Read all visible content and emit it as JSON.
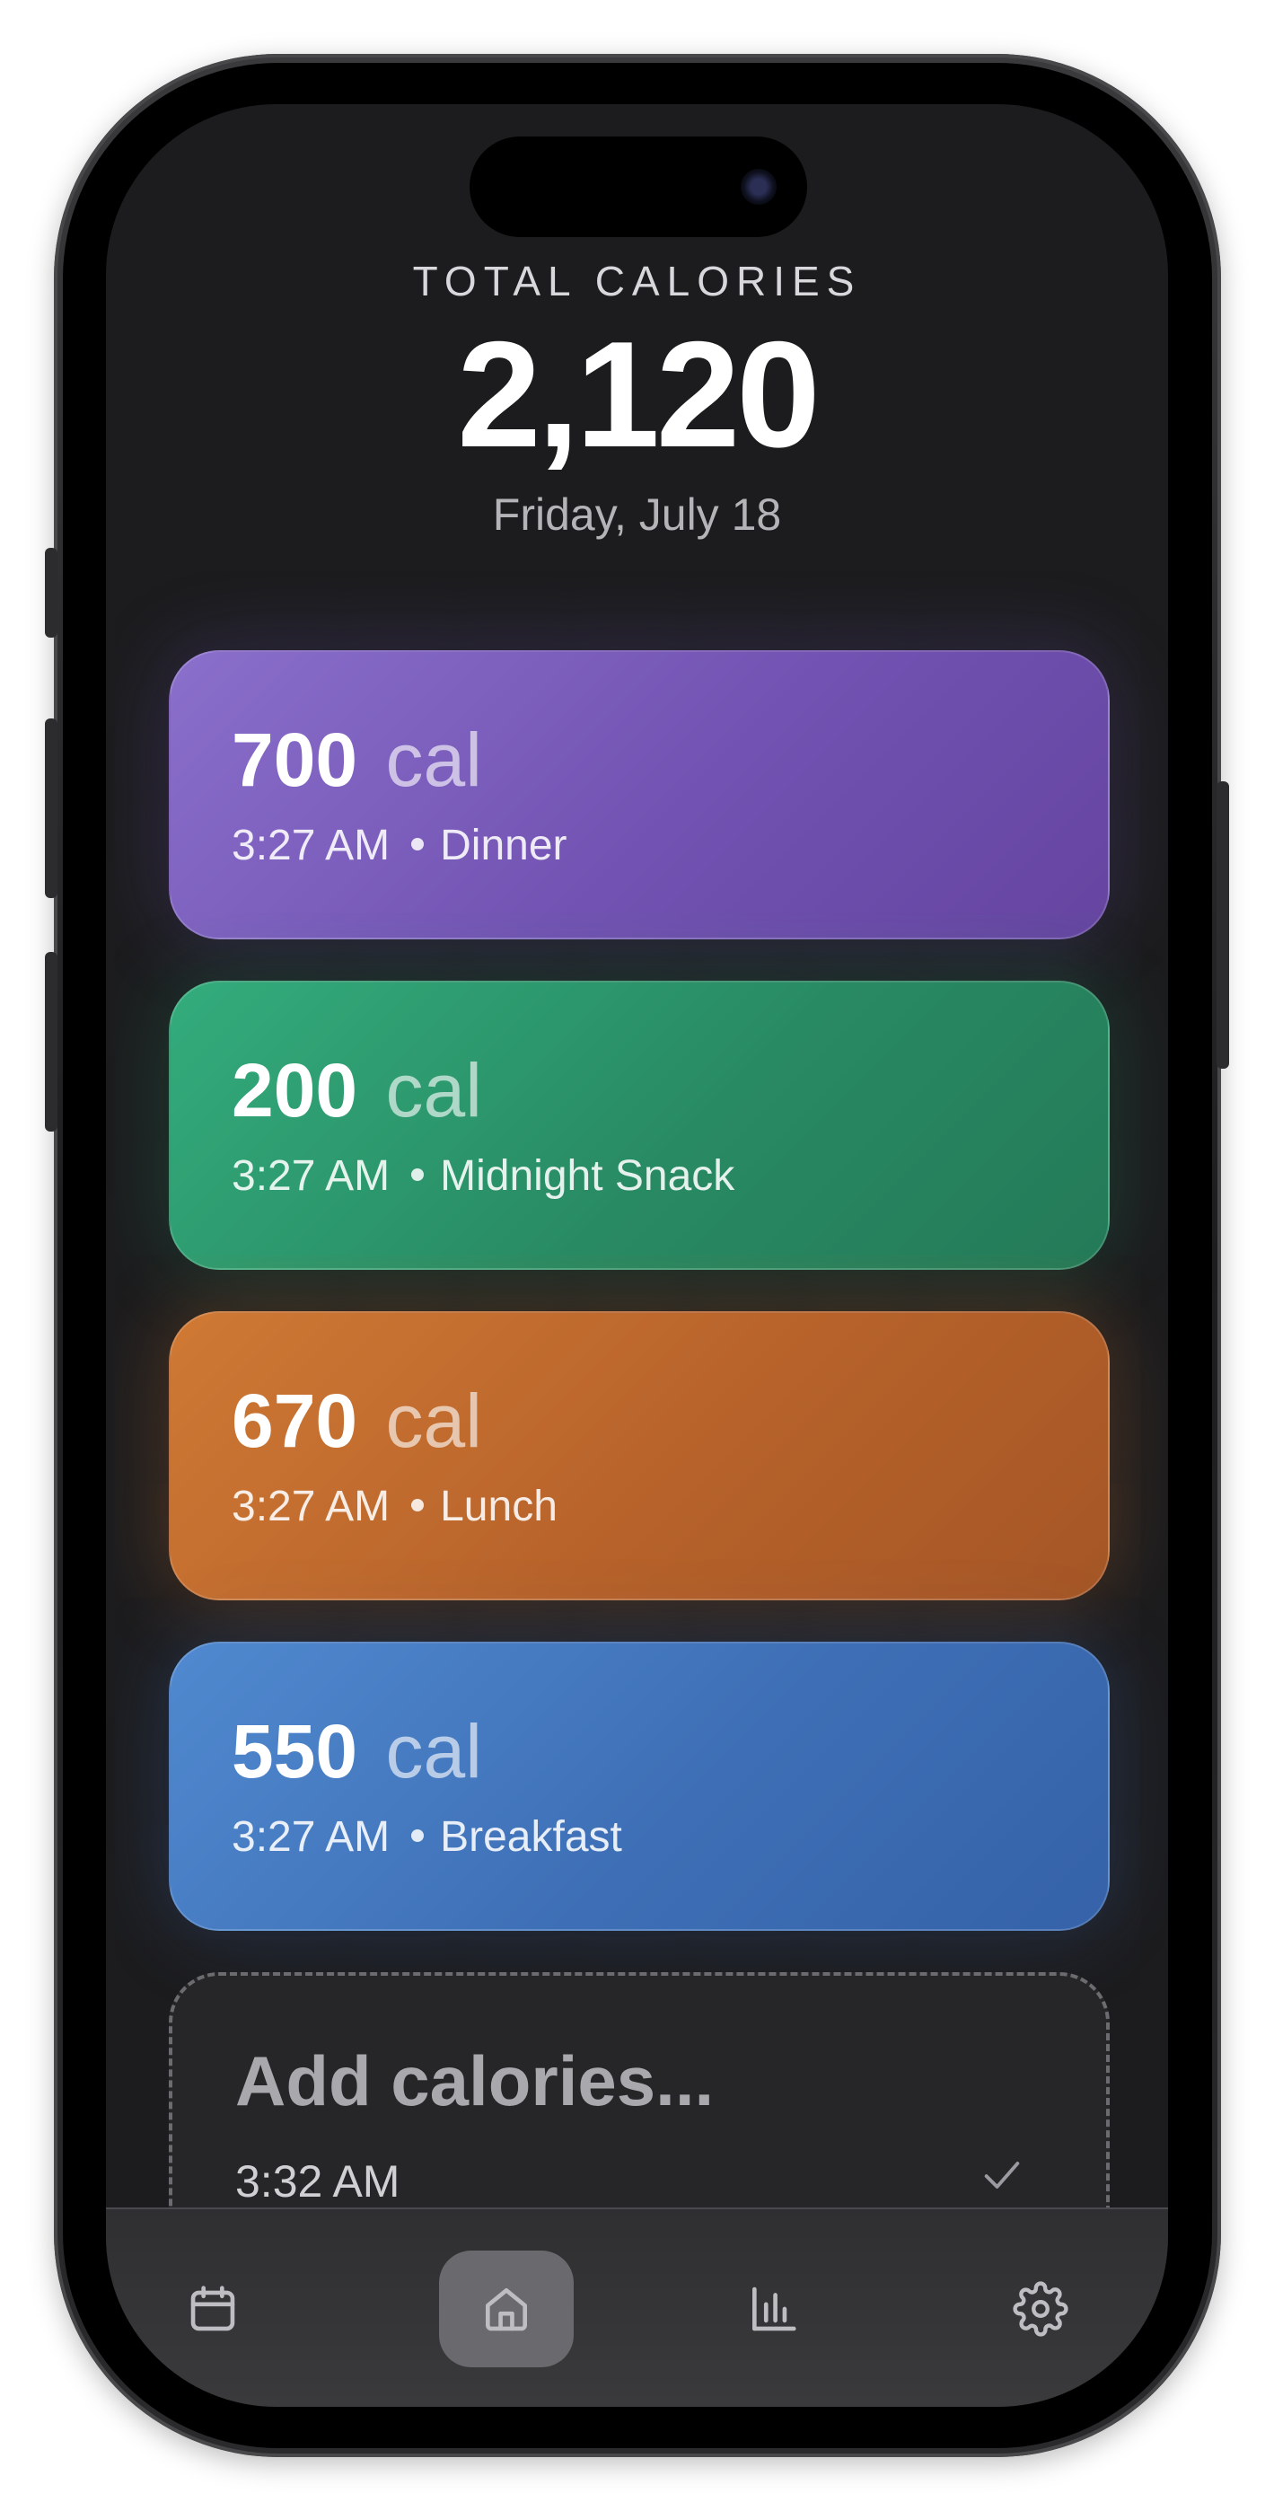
{
  "header": {
    "label": "TOTAL CALORIES",
    "total": "2,120",
    "date": "Friday, July 18"
  },
  "entries": [
    {
      "amount": "700",
      "unit": "cal",
      "time": "3:27 AM",
      "meal": "Dinner",
      "color": "#7252b2"
    },
    {
      "amount": "200",
      "unit": "cal",
      "time": "3:27 AM",
      "meal": "Midnight Snack",
      "color": "#288a63"
    },
    {
      "amount": "670",
      "unit": "cal",
      "time": "3:27 AM",
      "meal": "Lunch",
      "color": "#b7622a"
    },
    {
      "amount": "550",
      "unit": "cal",
      "time": "3:27 AM",
      "meal": "Breakfast",
      "color": "#3e6fb6"
    }
  ],
  "add_entry": {
    "placeholder": "Add calories...",
    "time": "3:32 AM",
    "confirm_icon": "checkmark-icon"
  },
  "tabbar": {
    "tabs": [
      {
        "icon": "calendar-icon"
      },
      {
        "icon": "home-icon",
        "active": true
      },
      {
        "icon": "bar-chart-icon"
      },
      {
        "icon": "gear-icon"
      }
    ]
  }
}
